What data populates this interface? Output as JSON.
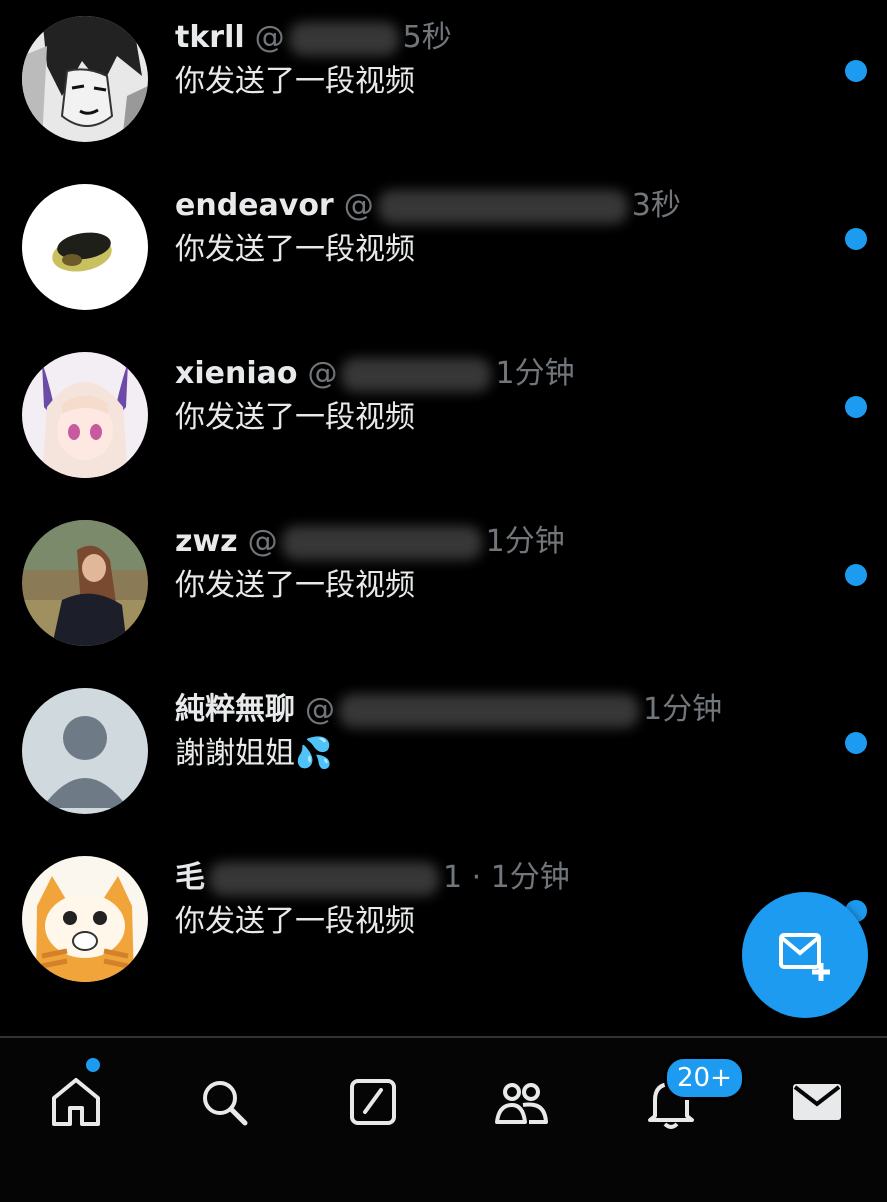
{
  "conversations": [
    {
      "name": "tkrll",
      "handle": "@",
      "time": "5秒",
      "message": "你发送了一段视频",
      "avatar_icon": "manga-character-avatar",
      "unread": true
    },
    {
      "name": "endeavor",
      "handle": "@",
      "time": "3秒",
      "message": "你发送了一段视频",
      "avatar_icon": "avocado-avatar",
      "unread": true
    },
    {
      "name": "xieniao",
      "handle": "@",
      "time": "1分钟",
      "message": "你发送了一段视频",
      "avatar_icon": "anime-girl-avatar",
      "unread": true
    },
    {
      "name": "zwz",
      "handle": "@",
      "time": "1分钟",
      "message": "你发送了一段视频",
      "avatar_icon": "photo-person-avatar",
      "unread": true
    },
    {
      "name": "純粹無聊",
      "handle": "@",
      "time": "1分钟",
      "message": "謝謝姐姐💦",
      "avatar_icon": "default-user-avatar",
      "unread": true
    },
    {
      "name": "毛",
      "handle": "",
      "time": "1 · 1分钟",
      "message": "你发送了一段视频",
      "avatar_icon": "cartoon-cat-avatar",
      "unread": true
    }
  ],
  "fab": {
    "icon": "new-message-icon"
  },
  "tabbar": {
    "items": [
      {
        "name": "home",
        "icon": "home-icon"
      },
      {
        "name": "search",
        "icon": "search-icon"
      },
      {
        "name": "compose",
        "icon": "compose-icon"
      },
      {
        "name": "communities",
        "icon": "people-icon"
      },
      {
        "name": "notifications",
        "icon": "bell-icon"
      },
      {
        "name": "messages",
        "icon": "mail-icon"
      }
    ],
    "notifications_badge": "20+"
  },
  "colors": {
    "accent": "#1d9bf0",
    "background": "#000000",
    "secondary_text": "#71767b"
  }
}
